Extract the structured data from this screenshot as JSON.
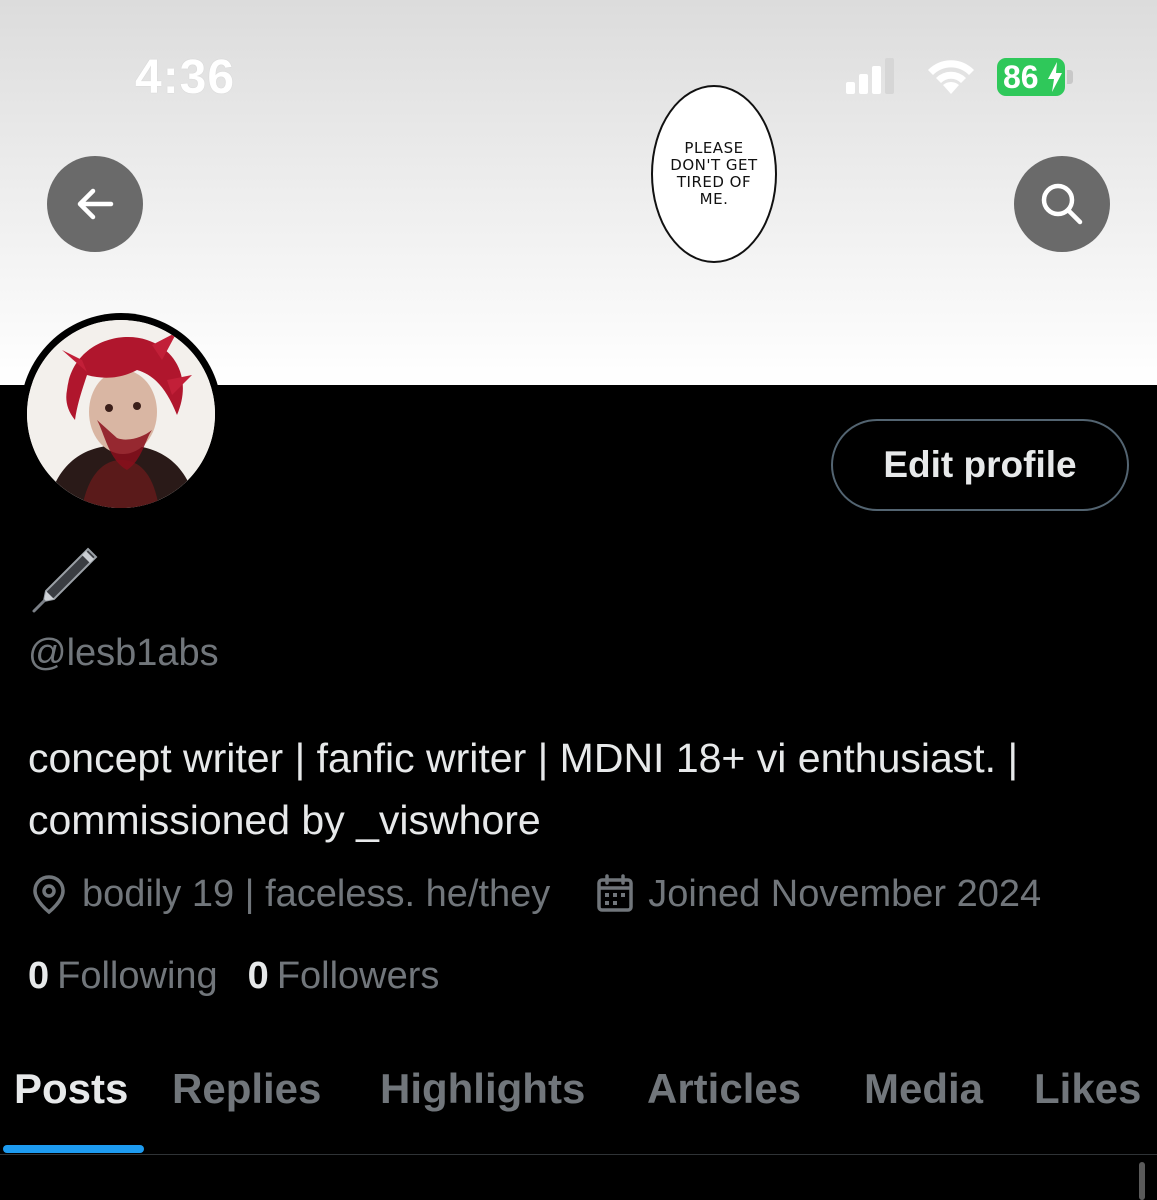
{
  "status_bar": {
    "time": "4:36",
    "battery": "86"
  },
  "banner": {
    "speech_bubble_text": "PLEASE DON'T GET TIRED OF ME."
  },
  "header": {
    "back_icon": "arrow-left-icon",
    "search_icon": "search-icon"
  },
  "profile": {
    "edit_profile_label": "Edit profile",
    "display_name_emoji": "pen-icon",
    "handle": "@lesb1abs",
    "bio": "concept writer | fanfic writer | MDNI 18+ vi enthusiast. | commissioned by _viswhore",
    "location": "bodily 19 | faceless. he/they",
    "joined": "Joined November 2024",
    "following_count": "0",
    "following_label": "Following",
    "followers_count": "0",
    "followers_label": "Followers"
  },
  "tabs": [
    {
      "label": "Posts",
      "active": true
    },
    {
      "label": "Replies",
      "active": false
    },
    {
      "label": "Highlights",
      "active": false
    },
    {
      "label": "Articles",
      "active": false
    },
    {
      "label": "Media",
      "active": false
    },
    {
      "label": "Likes",
      "active": false
    }
  ],
  "colors": {
    "accent": "#1d9bf0",
    "secondary_text": "#71767b",
    "battery": "#2fc85a"
  }
}
